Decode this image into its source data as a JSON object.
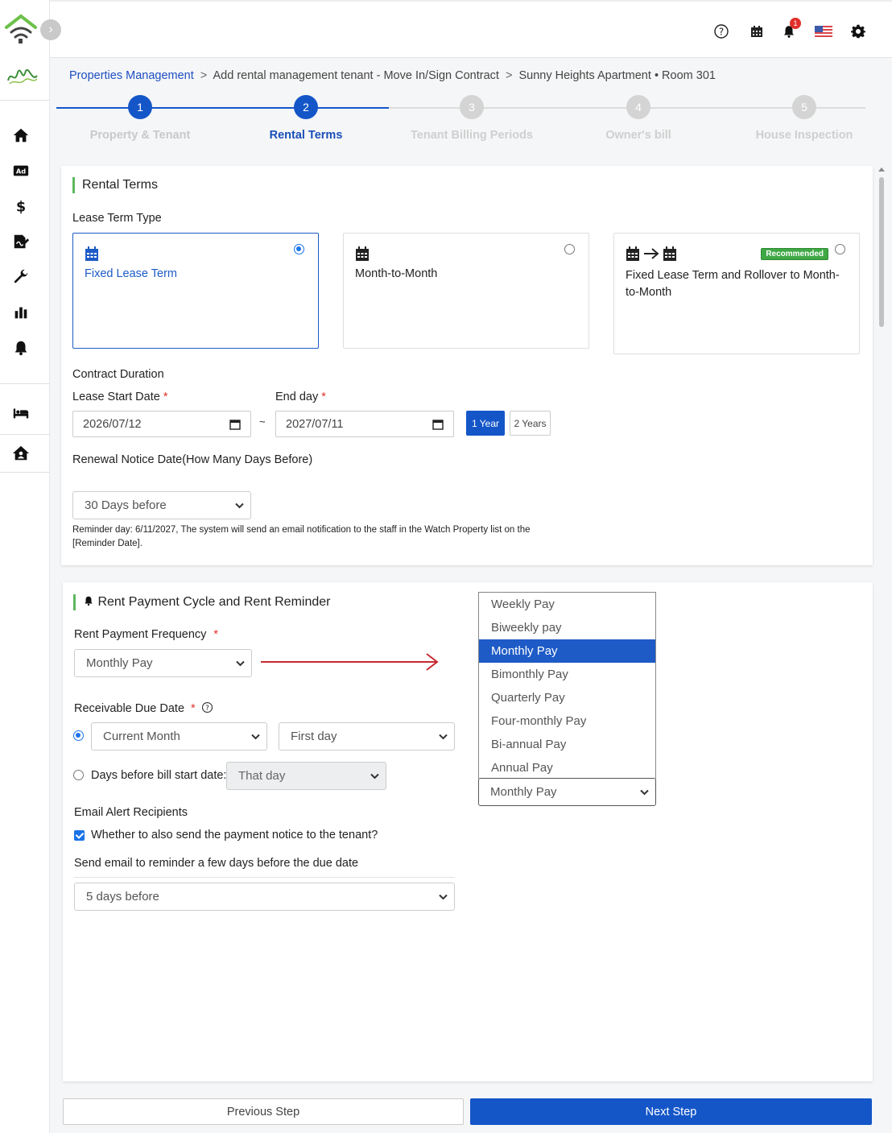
{
  "breadcrumb": {
    "root": "Properties Management",
    "separator": ">",
    "page": "Add rental management tenant - Move In/Sign Contract",
    "property": "Sunny Heights Apartment",
    "dot": "•",
    "room": "Room 301"
  },
  "topbar": {
    "notification_count": "1"
  },
  "steps": [
    {
      "number": "1",
      "label": "Property & Tenant",
      "state": "done"
    },
    {
      "number": "2",
      "label": "Rental Terms",
      "state": "active"
    },
    {
      "number": "3",
      "label": "Tenant Billing Periods",
      "state": "pending"
    },
    {
      "number": "4",
      "label": "Owner's bill",
      "state": "pending"
    },
    {
      "number": "5",
      "label": "House Inspection",
      "state": "pending"
    }
  ],
  "rental_terms": {
    "title": "Rental Terms",
    "lease_term_type_label": "Lease Term Type",
    "options": [
      {
        "title": "Fixed Lease Term",
        "selected": true
      },
      {
        "title": "Month-to-Month",
        "selected": false
      },
      {
        "title": "Fixed Lease Term and Rollover to Month-to-Month",
        "selected": false,
        "badge": "Recommended"
      }
    ],
    "contract_duration_label": "Contract Duration",
    "start_date_label": "Lease Start Date",
    "start_date_value": "2026/07/12",
    "tilde": "~",
    "end_day_label": "End day",
    "end_date_value": "2027/07/11",
    "required_mark": "*",
    "one_year_label": "1 Year",
    "two_years_label": "2 Years",
    "renewal_label": "Renewal Notice Date(How Many  Days Before)",
    "renewal_value": "30 Days before",
    "reminder_note": "Reminder day: 6/11/2027, The system will send an email notification to the staff in the Watch Property list on the [Reminder Date]."
  },
  "rent_cycle": {
    "title": "Rent Payment Cycle and Rent Reminder",
    "frequency_label": "Rent Payment Frequency",
    "frequency_value": "Monthly Pay",
    "due_date_label": "Receivable Due Date",
    "due_month_value": "Current Month",
    "due_day_value": "First day",
    "days_before_label": "Days before bill start date:",
    "days_before_value": "That day",
    "email_recipients_label": "Email Alert Recipients",
    "send_to_tenant_label": "Whether to also send the payment notice to the tenant?",
    "send_before_label": "Send email to reminder a few days before the due date",
    "send_before_value": "5 days before"
  },
  "dropdown": {
    "options": [
      "Weekly Pay",
      "Biweekly pay",
      "Monthly Pay",
      "Bimonthly Pay",
      "Quarterly Pay",
      "Four-monthly Pay",
      "Bi-annual Pay",
      "Annual Pay"
    ],
    "selected": "Monthly Pay",
    "current_value": "Monthly Pay"
  },
  "footer": {
    "previous_label": "Previous Step",
    "next_label": "Next Step"
  },
  "colors": {
    "primary": "#1456c8",
    "accent_green": "#5cb85c",
    "required_red": "#e0302b",
    "arrow_red": "#c62b32"
  }
}
